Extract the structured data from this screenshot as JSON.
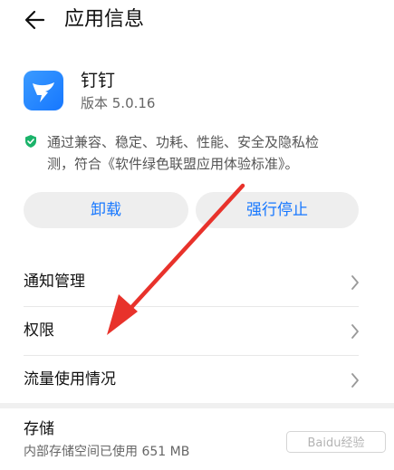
{
  "header": {
    "title": "应用信息"
  },
  "app": {
    "name": "钉钉",
    "version": "版本 5.0.16",
    "verify_line1": "通过兼容、稳定、功耗、性能、安全及隐私检",
    "verify_line2": "测，符合《软件绿色联盟应用体验标准》。"
  },
  "actions": {
    "uninstall_label": "卸载",
    "force_stop_label": "强行停止"
  },
  "settings": {
    "items": [
      {
        "label": "通知管理"
      },
      {
        "label": "权限"
      },
      {
        "label": "流量使用情况"
      }
    ]
  },
  "storage": {
    "title": "存储",
    "usage": "内部存储空间已使用 651 MB"
  },
  "colors": {
    "accent": "#1677ff",
    "annotation_arrow": "#e8322b",
    "verify_green": "#1bb36a"
  },
  "watermark": {
    "text": "Baidu经验"
  }
}
